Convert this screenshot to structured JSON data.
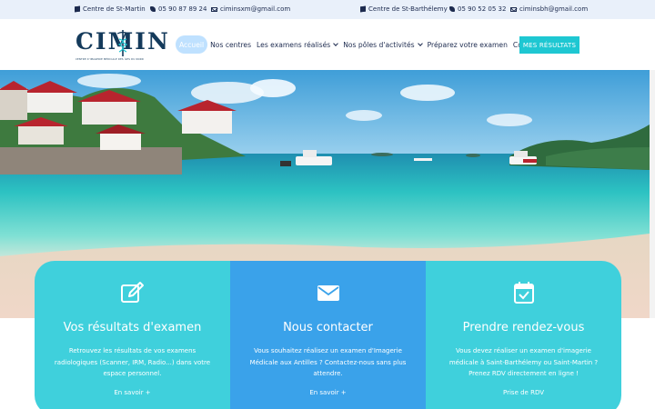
{
  "topbar": {
    "left": [
      {
        "icon": "map-icon",
        "text": "Centre de St-Martin"
      },
      {
        "icon": "phone-icon",
        "text": "05 90 87 89 24"
      },
      {
        "icon": "mail-icon",
        "text": "ciminsxm@gmail.com"
      }
    ],
    "right": [
      {
        "icon": "map-icon",
        "text": "Centre de St-Barthélemy"
      },
      {
        "icon": "phone-icon",
        "text": "05 90 52 05 32"
      },
      {
        "icon": "mail-icon",
        "text": "ciminsbh@gmail.com"
      }
    ]
  },
  "logo": {
    "text": "CIMIN",
    "subtitle": "CENTRE D'IMAGERIE MÉDICALE DES ÎLES DU NORD"
  },
  "nav": {
    "items": [
      {
        "label": "Accueil",
        "active": true
      },
      {
        "label": "Nos centres"
      },
      {
        "label": "Les examens réalisés",
        "dropdown": true
      },
      {
        "label": "Nos pôles d'activités",
        "dropdown": true
      },
      {
        "label": "Préparez votre examen"
      },
      {
        "label": "Contact"
      }
    ],
    "cta": "MES RÉSULTATS"
  },
  "colors": {
    "accent": "#1ec7d2",
    "navy": "#143a5b",
    "card_teal": "#3fd0dc",
    "card_blue": "#3aa2ea"
  },
  "cards": [
    {
      "icon": "edit-icon",
      "title": "Vos résultats d'examen",
      "text": "Retrouvez les résultats de vos examens radiologiques (Scanner, IRM, Radio...) dans votre espace personnel.",
      "link": "En savoir +"
    },
    {
      "icon": "envelope-icon",
      "title": "Nous contacter",
      "text": "Vous souhaitez réalisez un examen d'Imagerie Médicale aux Antilles ? Contactez-nous sans plus attendre.",
      "link": "En savoir +"
    },
    {
      "icon": "calendar-check-icon",
      "title": "Prendre rendez-vous",
      "text": "Vous devez réaliser un examen d'imagerie médicale à Saint-Barthélemy ou Saint-Martin ? Prenez RDV directement en ligne !",
      "link": "Prise de RDV"
    }
  ]
}
